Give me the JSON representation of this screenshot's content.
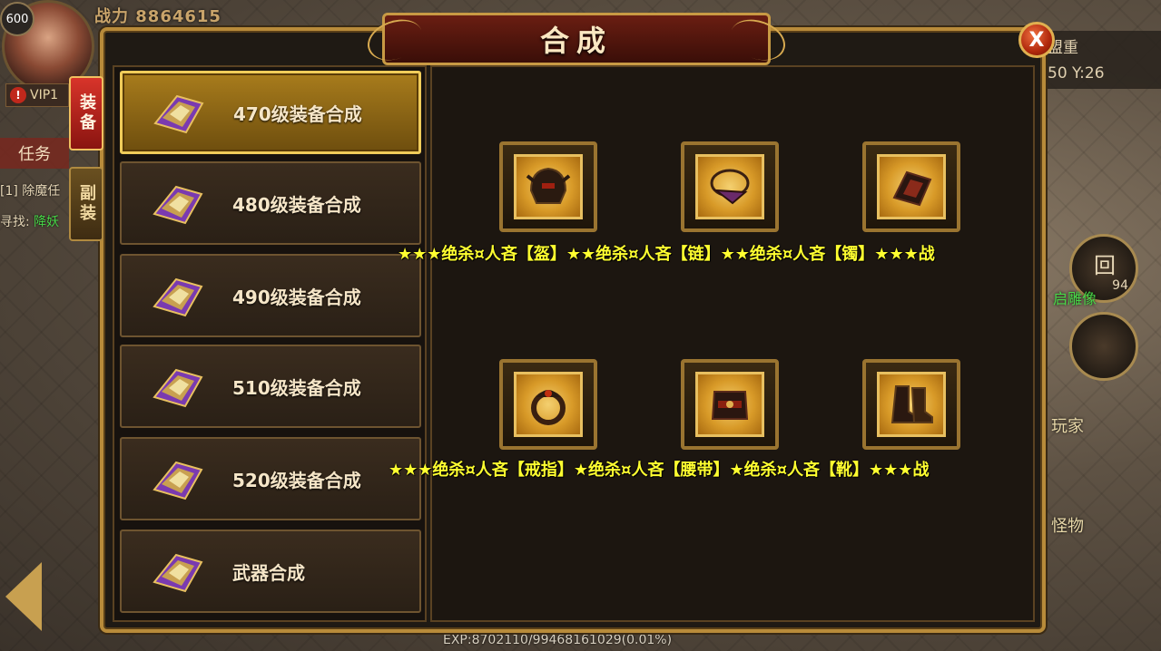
{
  "hud": {
    "level": "600",
    "power_label": "战力",
    "power_value": "8864615",
    "vip_text": "VIP1",
    "task_tab": "任务",
    "quest_line_1": "[1] 除魔任",
    "quest_line_2_label": "寻找:",
    "quest_line_2_target": "降妖",
    "coord_line_1": "盟重",
    "coord_line_2": "50 Y:26",
    "skill_count": "94",
    "side_label_1": "玩家",
    "side_label_2": "怪物",
    "side_label_3": "启雕像",
    "exp_text": "EXP:8702110/99468161029(0.01%)"
  },
  "dialog": {
    "title": "合成",
    "close_label": "X",
    "category_tabs": [
      {
        "label": "装备",
        "active": true
      },
      {
        "label": "副装",
        "active": false
      }
    ],
    "recipes": [
      {
        "label": "470级装备合成",
        "selected": true
      },
      {
        "label": "480级装备合成",
        "selected": false
      },
      {
        "label": "490级装备合成",
        "selected": false
      },
      {
        "label": "510级装备合成",
        "selected": false
      },
      {
        "label": "520级装备合成",
        "selected": false
      },
      {
        "label": "武器合成",
        "selected": false
      }
    ],
    "items": [
      {
        "icon": "helmet-icon"
      },
      {
        "icon": "necklace-icon"
      },
      {
        "icon": "bracer-icon"
      },
      {
        "icon": "ring-icon"
      },
      {
        "icon": "belt-icon"
      },
      {
        "icon": "boots-icon"
      }
    ],
    "caption_row_1": "★★★绝杀¤人吝【盔】★★绝杀¤人吝【链】★★绝杀¤人吝【镯】★★★战",
    "caption_row_2": "★★★绝杀¤人吝【戒指】★绝杀¤人吝【腰带】★绝杀¤人吝【靴】★★★战"
  },
  "colors": {
    "frame_gold": "#b88b3a",
    "title_red": "#6a1e12",
    "caption_yellow": "#ffff30",
    "tab_active_red": "#d8342a"
  }
}
